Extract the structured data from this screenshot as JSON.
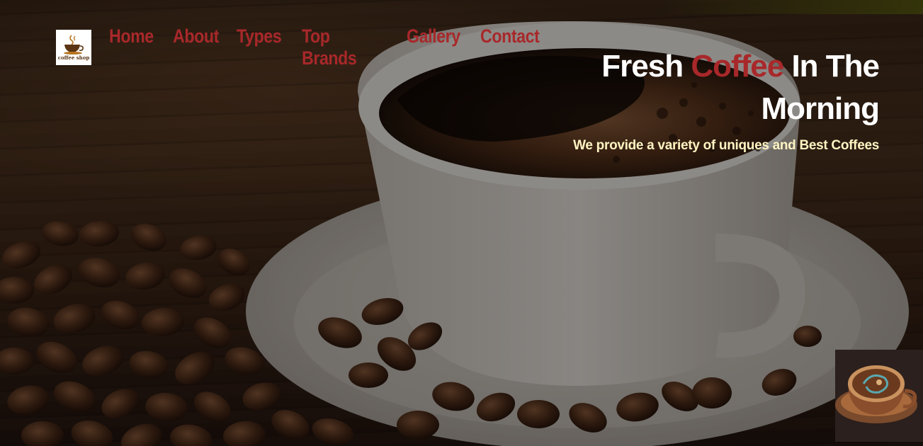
{
  "logo": {
    "text": "coffee shop"
  },
  "nav": {
    "items": [
      {
        "label": "Home"
      },
      {
        "label": "About"
      },
      {
        "label": "Types"
      },
      {
        "label": "Top Brands"
      },
      {
        "label": "Gallery"
      },
      {
        "label": "Contact"
      }
    ]
  },
  "hero": {
    "title_part1": "Fresh ",
    "title_accent": "Coffee",
    "title_part2": " In The Morning",
    "subtitle": "We provide a variety of uniques and Best Coffees"
  },
  "colors": {
    "accent": "#a8282a",
    "subtitle": "#fff4c2",
    "title": "#ffffff"
  }
}
